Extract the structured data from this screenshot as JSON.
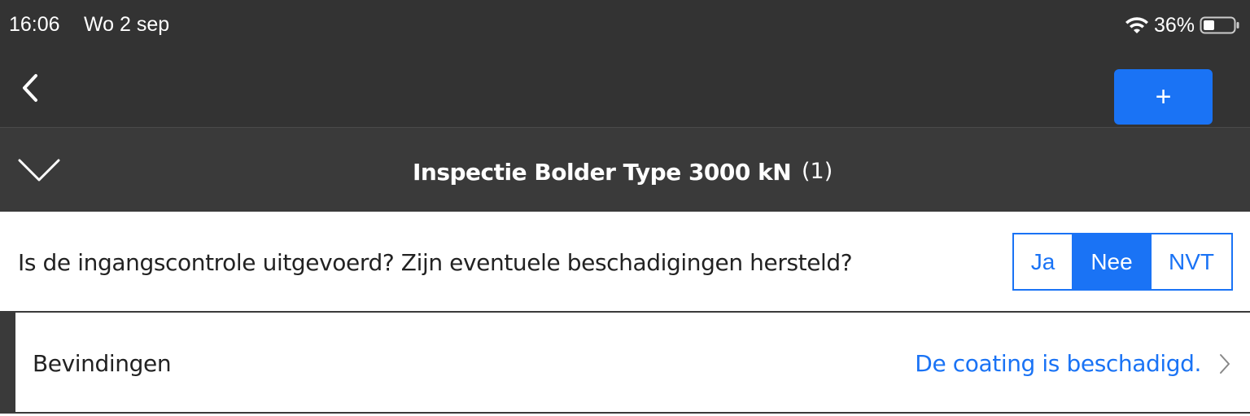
{
  "status_bar": {
    "time": "16:06",
    "date": "Wo 2 sep",
    "battery": "36%"
  },
  "nav": {
    "back_icon": "chevron-left-icon",
    "add_label": "+"
  },
  "section": {
    "title": "Inspectie Bolder Type 3000 kN",
    "count": "(1)",
    "toggle_icon": "chevron-down-icon"
  },
  "question": {
    "text": "Is de ingangscontrole uitgevoerd? Zijn eventuele beschadigingen hersteld?",
    "options": [
      "Ja",
      "Nee",
      "NVT"
    ],
    "selected": "Nee"
  },
  "finding": {
    "label": "Bevindingen",
    "value": "De coating is beschadigd."
  },
  "colors": {
    "accent": "#1a73f5",
    "header_bg": "#333333"
  }
}
